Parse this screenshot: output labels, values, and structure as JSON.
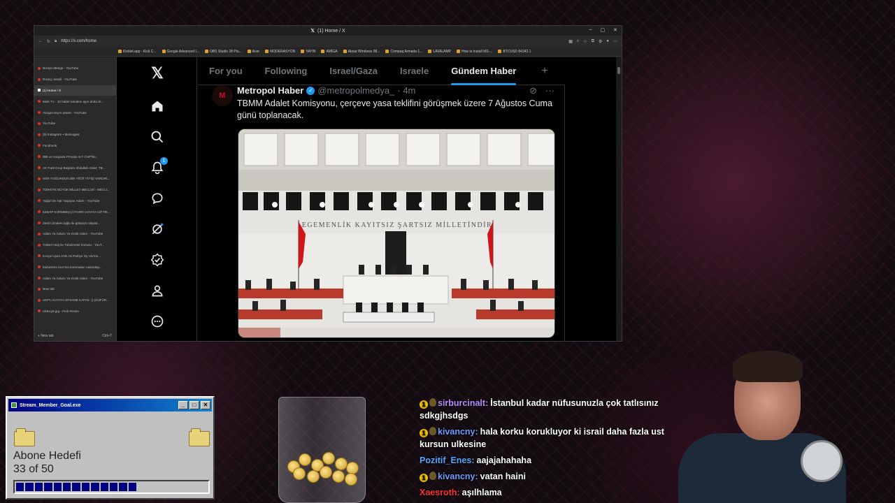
{
  "browser": {
    "window_title": "(1) Home / X",
    "url": "https://x.com/home",
    "window_controls": [
      "–",
      "▢",
      "✕"
    ],
    "bookmarks": [
      "Kicklet.app - Kick C...",
      "Google Advanced I...",
      "OBS Studio 28 Plu...",
      "Acer",
      "MODERASYON",
      "YAYIN",
      "AMİGA",
      "About Windows 98...",
      "Compaq Armada 1...",
      "LAVALAMP",
      "How to install MS-...",
      "BTCUSD 84342.1"
    ],
    "tabs": [
      {
        "title": "Nevşin Mengü - YouTube",
        "active": false
      },
      {
        "title": "Rockçı Serpil - YouTube",
        "active": false
      },
      {
        "title": "(1) Home / X",
        "active": true
      },
      {
        "title": "Multi TV - 10 haber kanalını aynı anda izl...",
        "active": false
      },
      {
        "title": "Yozgat seçim anketi - YouTube",
        "active": false
      },
      {
        "title": "YouTube",
        "active": false
      },
      {
        "title": "(9) Instagram • Messages",
        "active": false
      },
      {
        "title": "Facebook",
        "active": false
      },
      {
        "title": "İBB ve Anayasa Provası mı? CHP'lile...",
        "active": false
      },
      {
        "title": "AK Parti Grup Başkanı Abdullah Güler, TB...",
        "active": false
      },
      {
        "title": "HER YOĞURDUN BİR YİĞİT YİYİŞİ VARDIR...",
        "active": false
      },
      {
        "title": "TÜRKİYE BÜYÜK MİLLET MECLİSİ - MECLİ...",
        "active": false
      },
      {
        "title": "Yoğurt ile Aşk Yaşayan Adam - YouTube",
        "active": false
      },
      {
        "title": "KEBAP KORDBEÇÇİ FAHRİ USTAYA GİTTİK...",
        "active": false
      },
      {
        "title": "Zerrin Zindancıoğlu ile gökyüzü olaylar...",
        "active": false
      },
      {
        "title": "Adam Ya Adamı Ya Geldi Adam - YouTube",
        "active": false
      },
      {
        "title": "Yüksel Ataş ile Tubelmeler konusu - YouT...",
        "active": false
      },
      {
        "title": "Konya Uşan Artık Ak Partiye Oy Verme...",
        "active": false
      },
      {
        "title": "Muharrem İnce'nin korumaları vatandaş...",
        "active": false
      },
      {
        "title": "Adam Ya Adamı Ya Geldi Adam - YouTube",
        "active": false
      },
      {
        "title": "New tab",
        "active": false
      },
      {
        "title": "AKP'Lİ DAYIYA EFSANE KAPAK :)) (KÜFÜR...",
        "active": false
      },
      {
        "title": "rdde1y9.jpg - Frob Resim",
        "active": false
      }
    ],
    "new_tab_label": "New tab",
    "new_tab_shortcut": "Ctrl+T"
  },
  "x": {
    "nav_icons": [
      "x-logo-icon",
      "home-icon",
      "search-icon",
      "bell-icon",
      "messages-icon",
      "grok-icon",
      "verified-icon",
      "profile-icon",
      "more-icon"
    ],
    "notification_count": "1",
    "tabs": [
      "For you",
      "Following",
      "Israel/Gaza",
      "Israele",
      "Gündem Haber"
    ],
    "active_tab": "Gündem Haber",
    "add_tab": "+",
    "post": {
      "author": "Metropol Haber",
      "handle": "@metropolmedya_",
      "time": "· 4m",
      "avatar_letter": "M",
      "text": "TBMM Adalet Komisyonu, çerçeve yasa teklifini görüşmek üzere 7 Ağustos Cuma günü toplanacak.",
      "image_inscription": "EGEMENLİK KAYITSIZ ŞARTSIZ MİLLETİNDİR"
    }
  },
  "goal_widget": {
    "title": "Stream_Member_Goal.exe",
    "label": "Abone Hedefi",
    "progress_text": "33 of 50",
    "progress_fraction": 0.66
  },
  "chat": [
    {
      "badges": true,
      "user": "sirburcinalt:",
      "color": "#b98cff",
      "text": "İstanbul kadar nüfusunuzla çok tatlısınız sdkgjhsdgs"
    },
    {
      "badges": true,
      "user": "kivancny:",
      "color": "#6f9bff",
      "text": "hala korku korukluyor ki israil daha fazla ust kursun ulkesine"
    },
    {
      "badges": false,
      "user": "Pozitif_Enes:",
      "color": "#58a6ff",
      "text": "aajajahahaha"
    },
    {
      "badges": true,
      "user": "kivancny:",
      "color": "#6f9bff",
      "text": "vatan haini"
    },
    {
      "badges": false,
      "user": "Xaesroth:",
      "color": "#ff3030",
      "text": "aşılhlama"
    }
  ]
}
